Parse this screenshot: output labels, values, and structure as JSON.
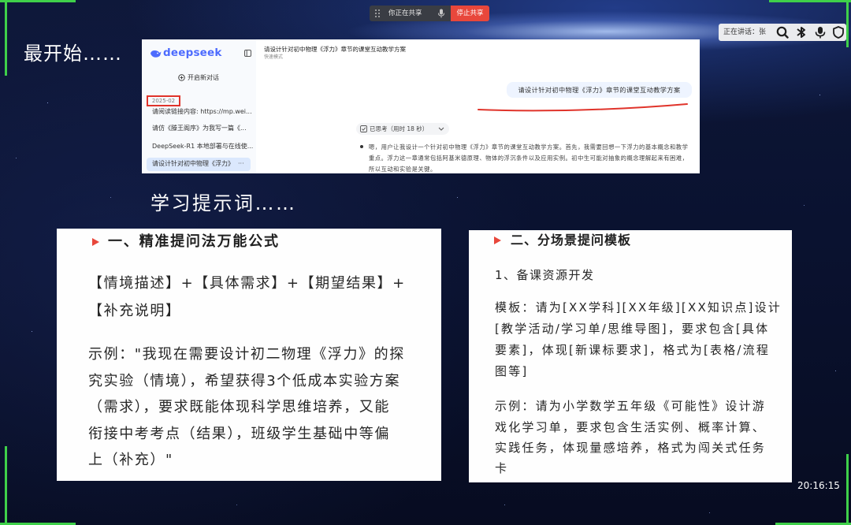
{
  "meeting": {
    "share_status": "你正在共享",
    "stop_share_label": "停止共享",
    "speaker_label": "正在讲话：张",
    "clock": "20:16:15"
  },
  "slide": {
    "heading_start": "最开始……",
    "heading_prompts": "学习提示词……",
    "deepseek_screenshot": {
      "logo_text": "deepseek",
      "new_chat_label": "开启新对话",
      "date_group": "2025-02",
      "history": [
        "请阅读链接内容: https://mp.wei...",
        "请仿《滕王阁序》为我写一篇《...",
        "DeepSeek-R1 本地部署与在线使...",
        "请设计针对初中物理《浮力》"
      ],
      "more_label": "···",
      "chat_title": "请设计针对初中物理《浮力》章节的课堂互动教学方案",
      "mode_label": "快速模式",
      "user_message": "请设计针对初中物理《浮力》章节的课堂互动教学方案",
      "thought_label": "已思考（用时 18 秒）",
      "answer_lines": [
        "嗯，用户让我设计一个针对初中物理《浮力》章节的课堂互动教学方案。首先，我需要回想一下浮力的基本概念和教学",
        "重点。浮力这一章通常包括阿基米德原理、物体的浮沉条件以及应用实例。初中生可能对抽象的概念理解起来有困难，",
        "所以互动和实验是关键。"
      ]
    },
    "card_left": {
      "title": "一、精准提问法万能公式",
      "formula_lines": [
        "【情境描述】+【具体需求】+【期望结果】+",
        "【补充说明】"
      ],
      "example_lines": [
        "示例：\"我现在需要设计初二物理《浮力》的探",
        "究实验（情境），希望获得3个低成本实验方案",
        "（需求），要求既能体现科学思维培养，又能",
        "衔接中考考点（结果），班级学生基础中等偏",
        "上（补充）\""
      ]
    },
    "card_right": {
      "title": "二、分场景提问模板",
      "section_title": "1、备课资源开发",
      "template_lines": [
        "模板：请为[XX学科][XX年级][XX知识点]设计",
        "[教学活动/学习单/思维导图]，要求包含[具体",
        "要素]，体现[新课标要求]，格式为[表格/流程",
        "图等]"
      ],
      "example_lines": [
        "示例：请为小学数学五年级《可能性》设计游",
        "戏化学习单，要求包含生活实例、概率计算、",
        "实践任务，体现量感培养，格式为闯关式任务",
        "卡"
      ]
    }
  },
  "icons": {
    "share_bar": [
      "drag-handle-icon",
      "mic-icon"
    ],
    "controls": [
      "zoom-icon",
      "network-icon",
      "mic-icon",
      "shield-icon"
    ],
    "deepseek": [
      "whale-logo-icon",
      "sidebar-toggle-icon",
      "plus-circle-icon",
      "thought-icon",
      "chevron-down-icon"
    ],
    "card_marker": "triangle-bullet-icon"
  },
  "colors": {
    "background": "#0b1330",
    "share_border_green": "#3fd04a",
    "stop_button_red": "#e8473b",
    "deepseek_blue": "#4d6bfe",
    "highlight_red": "#e0342b",
    "card_background": "#fefefe"
  }
}
